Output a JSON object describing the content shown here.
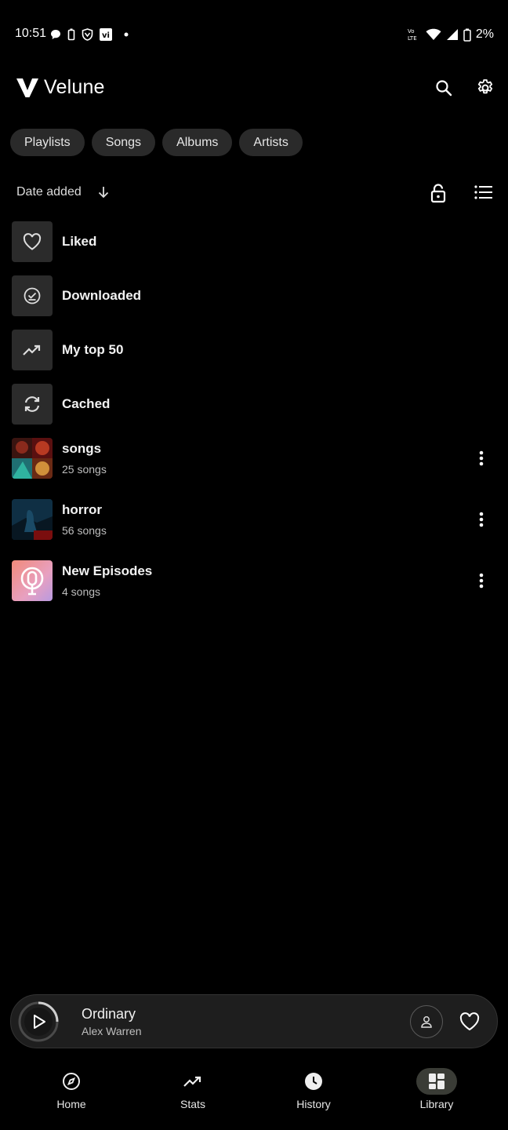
{
  "status_bar": {
    "time": "10:51",
    "battery": "2%",
    "icons": [
      "chat-bubble-icon",
      "battery-saver-icon",
      "vpn-shield-icon",
      "vi-app-icon",
      "dot-icon",
      "volte-icon",
      "wifi-icon",
      "cell-signal-icon",
      "battery-icon"
    ],
    "volte_label": "Vo LTE"
  },
  "app": {
    "title": "Velune",
    "logo_letter": "V"
  },
  "chips": [
    "Playlists",
    "Songs",
    "Albums",
    "Artists"
  ],
  "sort": {
    "label": "Date added"
  },
  "library": {
    "items": [
      {
        "name": "Liked",
        "icon": "heart-icon"
      },
      {
        "name": "Downloaded",
        "icon": "download-check-icon"
      },
      {
        "name": "My top 50",
        "icon": "trending-up-icon"
      },
      {
        "name": "Cached",
        "icon": "sync-icon"
      },
      {
        "name": "songs",
        "subtitle": "25 songs"
      },
      {
        "name": "horror",
        "subtitle": "56 songs"
      },
      {
        "name": "New Episodes",
        "subtitle": "4 songs"
      }
    ]
  },
  "player": {
    "song": "Ordinary",
    "artist": "Alex Warren"
  },
  "nav": {
    "items": [
      {
        "label": "Home",
        "icon": "compass-icon"
      },
      {
        "label": "Stats",
        "icon": "trending-up-icon"
      },
      {
        "label": "History",
        "icon": "clock-icon"
      },
      {
        "label": "Library",
        "icon": "library-grid-icon",
        "active": true
      }
    ]
  },
  "colors": {
    "background": "#000000",
    "chip": "#2a2a2a",
    "player": "#1e1e1e",
    "active_nav": "#3a3c36"
  }
}
